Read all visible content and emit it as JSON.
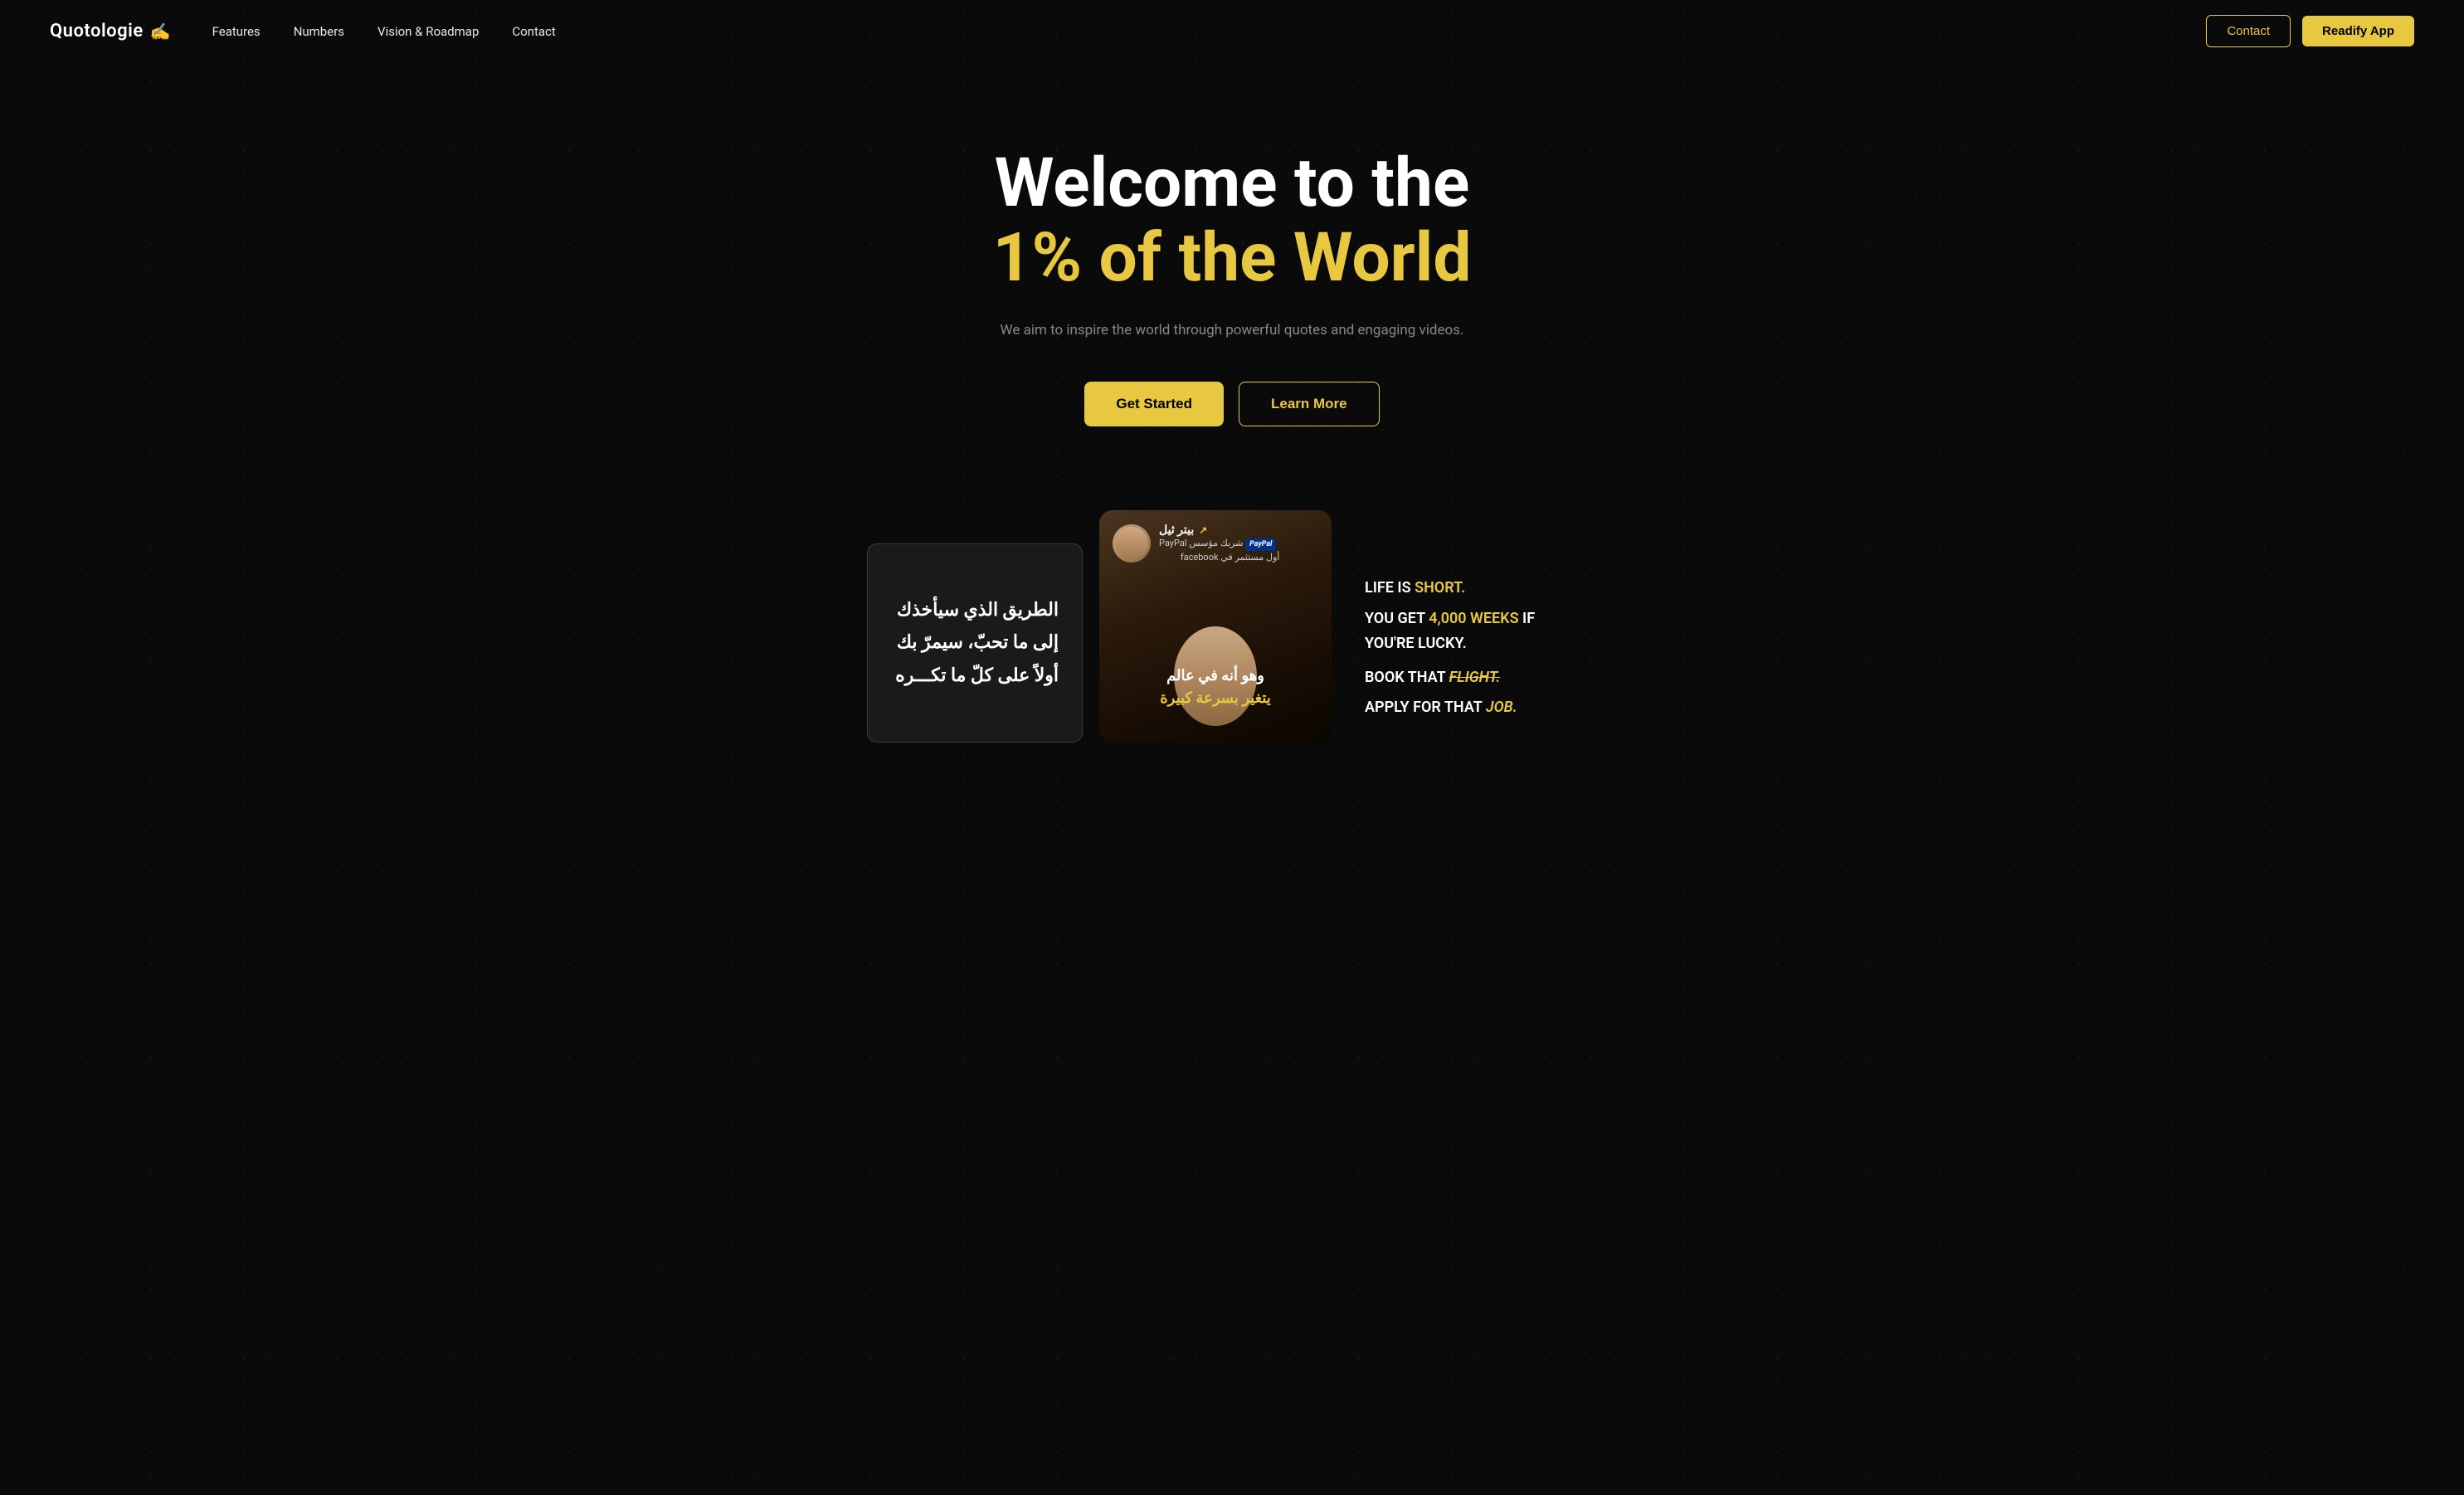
{
  "nav": {
    "logo_text": "Quotologie",
    "logo_icon": "✍",
    "links": [
      {
        "label": "Features",
        "href": "#"
      },
      {
        "label": "Numbers",
        "href": "#"
      },
      {
        "label": "Vision & Roadmap",
        "href": "#"
      },
      {
        "label": "Contact",
        "href": "#"
      }
    ],
    "btn_contact": "Contact",
    "btn_readify": "Readify App"
  },
  "hero": {
    "title_line1": "Welcome to the",
    "title_line2": "1% of the World",
    "subtitle": "We aim to inspire the world through powerful quotes and engaging videos.",
    "btn_get_started": "Get Started",
    "btn_learn_more": "Learn More"
  },
  "cards": {
    "arabic_card": {
      "lines": [
        "الطريق الذي سيأخذك",
        "إلى ما تحبّ، سيمرّ بك",
        "أولاً على كلّ ما تكـــره"
      ]
    },
    "video_card": {
      "speaker_name": "بيتر ثيل",
      "speaker_arrow": "↗",
      "speaker_role_line1": "شريك مؤسس PayPal",
      "speaker_role_line2": "أول مستثمر في facebook",
      "quote_line1": "وهو أنه في عالم",
      "quote_line2": "يتغير بسرعة كبيرة"
    },
    "text_card": {
      "line1": "LIFE IS ",
      "line1_highlight": "SHORT.",
      "line2": "YOU GET ",
      "line2_highlight": "4,000 WEEKS",
      "line2_rest": " IF YOU'RE LUCKY.",
      "line3": "BOOK THAT ",
      "line3_highlight": "FLIGHT.",
      "line4": "APPLY FOR THAT ",
      "line4_highlight": "JOB."
    }
  },
  "colors": {
    "accent": "#e8c840",
    "bg": "#0a0a0a",
    "text_muted": "#888888"
  }
}
